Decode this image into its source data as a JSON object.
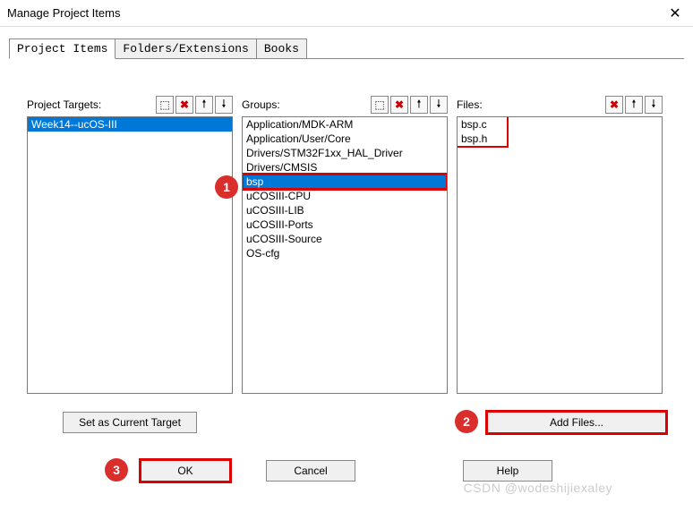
{
  "window": {
    "title": "Manage Project Items",
    "close_symbol": "✕"
  },
  "tabs": [
    {
      "label": "Project Items",
      "active": true
    },
    {
      "label": "Folders/Extensions",
      "active": false
    },
    {
      "label": "Books",
      "active": false
    }
  ],
  "columns": {
    "targets": {
      "label": "Project Targets:",
      "icons": [
        "new",
        "delete",
        "up",
        "down"
      ],
      "items": [
        {
          "text": "Week14--ucOS-III",
          "selected": true
        }
      ],
      "below_button": "Set as Current Target"
    },
    "groups": {
      "label": "Groups:",
      "icons": [
        "new",
        "delete",
        "up",
        "down"
      ],
      "items": [
        {
          "text": "Application/MDK-ARM",
          "selected": false
        },
        {
          "text": "Application/User/Core",
          "selected": false
        },
        {
          "text": "Drivers/STM32F1xx_HAL_Driver",
          "selected": false
        },
        {
          "text": "Drivers/CMSIS",
          "selected": false
        },
        {
          "text": "bsp",
          "selected": true
        },
        {
          "text": "uCOSIII-CPU",
          "selected": false
        },
        {
          "text": "uCOSIII-LIB",
          "selected": false
        },
        {
          "text": "uCOSIII-Ports",
          "selected": false
        },
        {
          "text": "uCOSIII-Source",
          "selected": false
        },
        {
          "text": "OS-cfg",
          "selected": false
        }
      ]
    },
    "files": {
      "label": "Files:",
      "icons": [
        "delete",
        "up",
        "down"
      ],
      "items": [
        {
          "text": "bsp.c",
          "selected": false
        },
        {
          "text": "bsp.h",
          "selected": false
        }
      ],
      "below_button": "Add Files..."
    }
  },
  "icon_glyphs": {
    "new": "⬚",
    "delete": "✖",
    "up": "🠕",
    "down": "🠗"
  },
  "buttons": {
    "ok": "OK",
    "cancel": "Cancel",
    "help": "Help"
  },
  "annotations": {
    "a1": "1",
    "a2": "2",
    "a3": "3"
  },
  "watermark": "CSDN @wodeshijiexaley"
}
